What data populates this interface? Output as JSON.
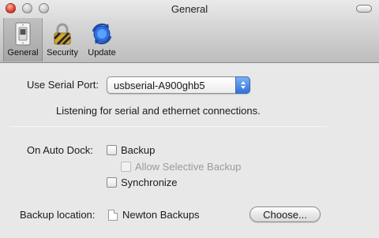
{
  "window": {
    "title": "General"
  },
  "toolbar": {
    "items": [
      {
        "label": "General",
        "icon": "switch-icon",
        "selected": true
      },
      {
        "label": "Security",
        "icon": "lock-icon",
        "selected": false
      },
      {
        "label": "Update",
        "icon": "update-icon",
        "selected": false
      }
    ]
  },
  "serial": {
    "label": "Use Serial Port:",
    "selected_value": "usbserial-A900ghb5",
    "status": "Listening for serial and ethernet connections."
  },
  "auto_dock": {
    "label": "On Auto Dock:",
    "backup_label": "Backup",
    "allow_selective_label": "Allow Selective Backup",
    "synchronize_label": "Synchronize"
  },
  "backup_location": {
    "label": "Backup location:",
    "folder": "Newton Backups",
    "choose_label": "Choose..."
  },
  "colors": {
    "accent": "#2f72d8",
    "close_button": "#e2412f"
  }
}
